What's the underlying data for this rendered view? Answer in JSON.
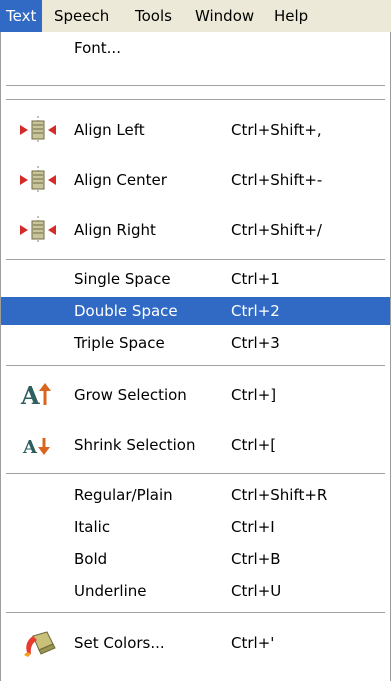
{
  "menubar": {
    "items": [
      {
        "label": "Text"
      },
      {
        "label": "Speech"
      },
      {
        "label": "Tools"
      },
      {
        "label": "Window"
      },
      {
        "label": "Help"
      }
    ]
  },
  "menu": {
    "font": "Font...",
    "align_left": {
      "label": "Align Left",
      "shortcut": "Ctrl+Shift+,"
    },
    "align_center": {
      "label": "Align Center",
      "shortcut": "Ctrl+Shift+-"
    },
    "align_right": {
      "label": "Align Right",
      "shortcut": "Ctrl+Shift+/"
    },
    "single_space": {
      "label": "Single Space",
      "shortcut": "Ctrl+1"
    },
    "double_space": {
      "label": "Double Space",
      "shortcut": "Ctrl+2"
    },
    "triple_space": {
      "label": "Triple Space",
      "shortcut": "Ctrl+3"
    },
    "grow_selection": {
      "label": "Grow Selection",
      "shortcut": "Ctrl+]"
    },
    "shrink_selection": {
      "label": "Shrink Selection",
      "shortcut": "Ctrl+["
    },
    "regular_plain": {
      "label": "Regular/Plain",
      "shortcut": "Ctrl+Shift+R"
    },
    "italic": {
      "label": "Italic",
      "shortcut": "Ctrl+I"
    },
    "bold": {
      "label": "Bold",
      "shortcut": "Ctrl+B"
    },
    "underline": {
      "label": "Underline",
      "shortcut": "Ctrl+U"
    },
    "set_colors": {
      "label": "Set Colors...",
      "shortcut": "Ctrl+'"
    }
  },
  "colors": {
    "selection": "#316ac5",
    "menubar_bg": "#ece9d8",
    "grow_arrow": "#d9651e",
    "shrink_arrow": "#d9651e"
  }
}
